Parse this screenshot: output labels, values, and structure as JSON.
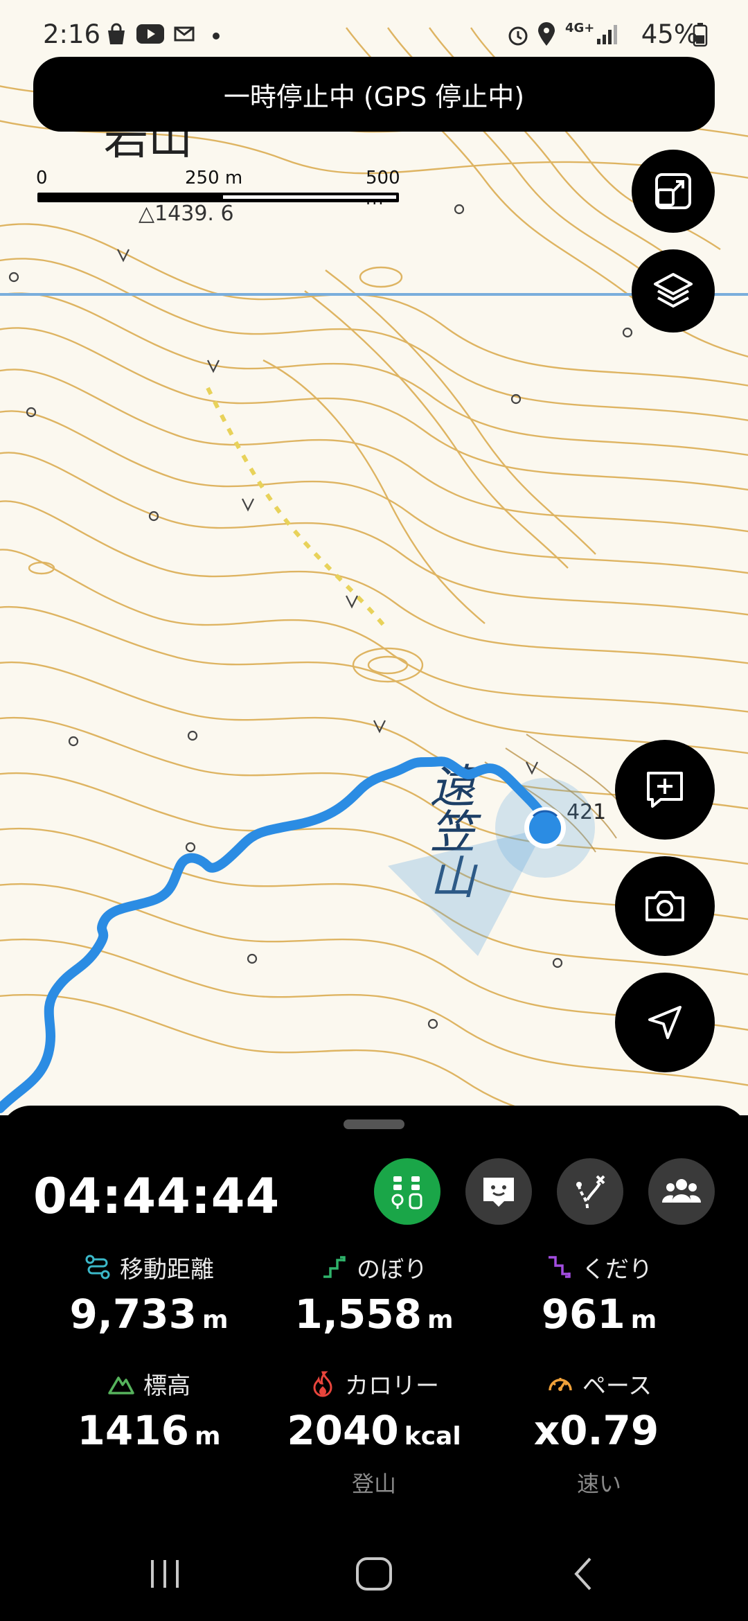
{
  "status_bar": {
    "time": "2:16",
    "battery": "45%",
    "network": "4G+",
    "left_icons": [
      "shopping-bag-icon",
      "youtube-icon",
      "mail-icon",
      "dot-icon"
    ],
    "right_icons": [
      "alarm-icon",
      "location-icon",
      "signal-icon",
      "battery-icon"
    ]
  },
  "banner": {
    "text": "一時停止中 (GPS 停止中)"
  },
  "scale": {
    "labels": [
      "0",
      "250 m",
      "500 m"
    ]
  },
  "map": {
    "labels": {
      "peak_name": "遠笠山",
      "elevation_top": "△1439. 6",
      "partial_top_label": "岩山",
      "peak_number": "421"
    },
    "colors": {
      "track": "#2b8ce3",
      "contour": "#d9a94a",
      "background": "#fbf8ef"
    }
  },
  "map_buttons": [
    {
      "icon": "fit-screen-icon"
    },
    {
      "icon": "layers-icon"
    },
    {
      "icon": "add-memo-icon"
    },
    {
      "icon": "camera-icon"
    },
    {
      "icon": "navigation-arrow-icon"
    }
  ],
  "panel": {
    "timer": "04:44:44",
    "mode_buttons": [
      {
        "icon": "hiking-mode-icon",
        "active": true
      },
      {
        "icon": "chat-face-icon",
        "active": false
      },
      {
        "icon": "route-branch-icon",
        "active": false
      },
      {
        "icon": "group-icon",
        "active": false
      }
    ],
    "stats": [
      {
        "label": "移動距離",
        "value": "9,733",
        "unit": "m",
        "icon": "distance-icon",
        "color": "#3bb8c9",
        "sub": ""
      },
      {
        "label": "のぼり",
        "value": "1,558",
        "unit": "m",
        "icon": "ascent-icon",
        "color": "#2fb36b",
        "sub": ""
      },
      {
        "label": "くだり",
        "value": "961",
        "unit": "m",
        "icon": "descent-icon",
        "color": "#a34de0",
        "sub": ""
      },
      {
        "label": "標高",
        "value": "1416",
        "unit": "m",
        "icon": "elevation-icon",
        "color": "#56b35c",
        "sub": ""
      },
      {
        "label": "カロリー",
        "value": "2040",
        "unit": "kcal",
        "icon": "flame-icon",
        "color": "#e8453c",
        "sub": "登山"
      },
      {
        "label": "ペース",
        "value": "x0.79",
        "unit": "",
        "icon": "speedometer-icon",
        "color": "#f0a13a",
        "sub": "速い"
      }
    ]
  },
  "nav_bar": {
    "buttons": [
      "recent-apps-icon",
      "home-icon",
      "back-icon"
    ]
  }
}
